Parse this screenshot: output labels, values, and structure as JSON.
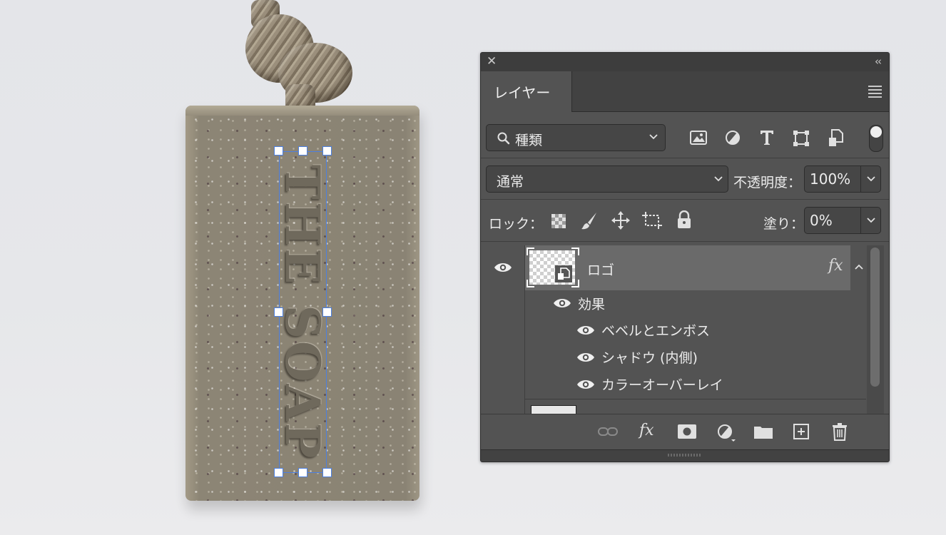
{
  "canvas": {
    "soap_engraving": "THE SOAP"
  },
  "layers_panel": {
    "tab_label": "レイヤー",
    "filter_kind_label": "種類",
    "blend_mode": "通常",
    "opacity_label": "不透明度：",
    "opacity_value": "100%",
    "lock_label": "ロック：",
    "fill_label": "塗り：",
    "fill_value": "0%",
    "layer": {
      "name": "ロゴ",
      "fx_badge": "fx",
      "effects_label": "効果",
      "effects": [
        "ベベルとエンボス",
        "シャドウ (内側)",
        "カラーオーバーレイ"
      ]
    },
    "footer_fx_label": "fx"
  },
  "icons": {
    "close": "close-icon",
    "collapse": "collapse-panel-icon",
    "menu": "panel-menu-icon",
    "search": "search-icon",
    "filter_image": "image-filter-icon",
    "filter_adjustment": "adjustment-filter-icon",
    "filter_type": "type-filter-icon",
    "filter_shape": "shape-filter-icon",
    "filter_smart_object": "smart-object-filter-icon",
    "lock_pixels": "lock-transparent-pixels-icon",
    "lock_image": "lock-image-pixels-icon",
    "lock_position": "lock-position-icon",
    "lock_artboard": "lock-artboard-icon",
    "lock_all": "lock-all-icon",
    "visibility": "eye-icon"
  },
  "colors": {
    "panel_bg": "#535353",
    "selected_layer_bg": "#6a6a6a",
    "selection_handle": "#4c7fe0"
  }
}
